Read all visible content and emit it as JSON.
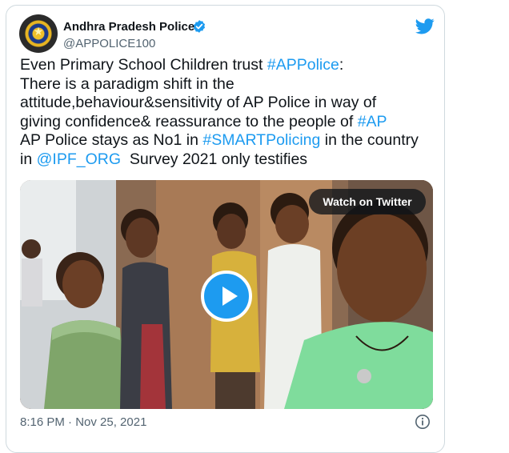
{
  "tweet": {
    "author_name": "Andhra Pradesh Police",
    "author_handle": "@APPOLICE100",
    "text_parts": [
      "Even Primary School Children trust ",
      "#APPolice",
      ":\nThere is a paradigm shift in the\nattitude,behaviour&sensitivity of AP Police in way of\ngiving confidence& reassurance to the people of ",
      "#AP",
      "\nAP Police stays as No1 in ",
      "#SMARTPolicing",
      " in the country\nin ",
      "@IPF_ORG",
      "  Survey 2021 only testifies"
    ],
    "timestamp": "8:16 PM · Nov 25, 2021"
  },
  "media": {
    "watch_label": "Watch on Twitter"
  },
  "icons": {
    "verified": "verified-badge-icon",
    "brand": "twitter-bird-icon",
    "play": "play-icon",
    "info": "info-icon"
  },
  "colors": {
    "link": "#1d9bf0",
    "text": "#0f1419",
    "muted": "#536471",
    "border": "#cfd9de"
  }
}
